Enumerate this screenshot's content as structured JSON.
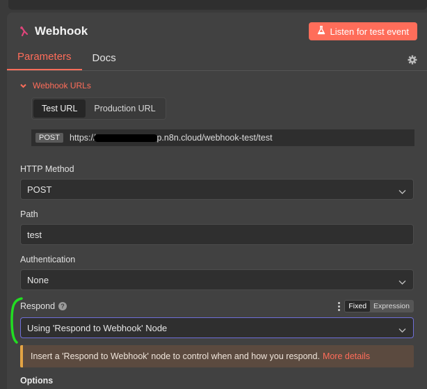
{
  "header": {
    "title": "Webhook",
    "listen_label": "Listen for test event"
  },
  "tabs": [
    {
      "label": "Parameters",
      "active": true
    },
    {
      "label": "Docs",
      "active": false
    }
  ],
  "webhook_urls": {
    "section_label": "Webhook URLs",
    "url_tabs": [
      {
        "label": "Test URL",
        "active": true
      },
      {
        "label": "Production URL",
        "active": false
      }
    ],
    "method_badge": "POST",
    "url_prefix": "https://",
    "url_suffix": "p.n8n.cloud/webhook-test/test"
  },
  "http_method": {
    "label": "HTTP Method",
    "value": "POST"
  },
  "path": {
    "label": "Path",
    "value": "test"
  },
  "authentication": {
    "label": "Authentication",
    "value": "None"
  },
  "respond": {
    "label": "Respond",
    "help": "?",
    "toggle": [
      "Fixed",
      "Expression"
    ],
    "toggle_selected": "Fixed",
    "value": "Using 'Respond to Webhook' Node"
  },
  "notice": {
    "text": "Insert a 'Respond to Webhook' node to control when and how you respond.",
    "link": "More details"
  },
  "options_label": "Options",
  "colors": {
    "accent": "#ff6d5a",
    "panel": "#414141",
    "warning_border": "#e3a444",
    "annotation": "#22dd22"
  }
}
